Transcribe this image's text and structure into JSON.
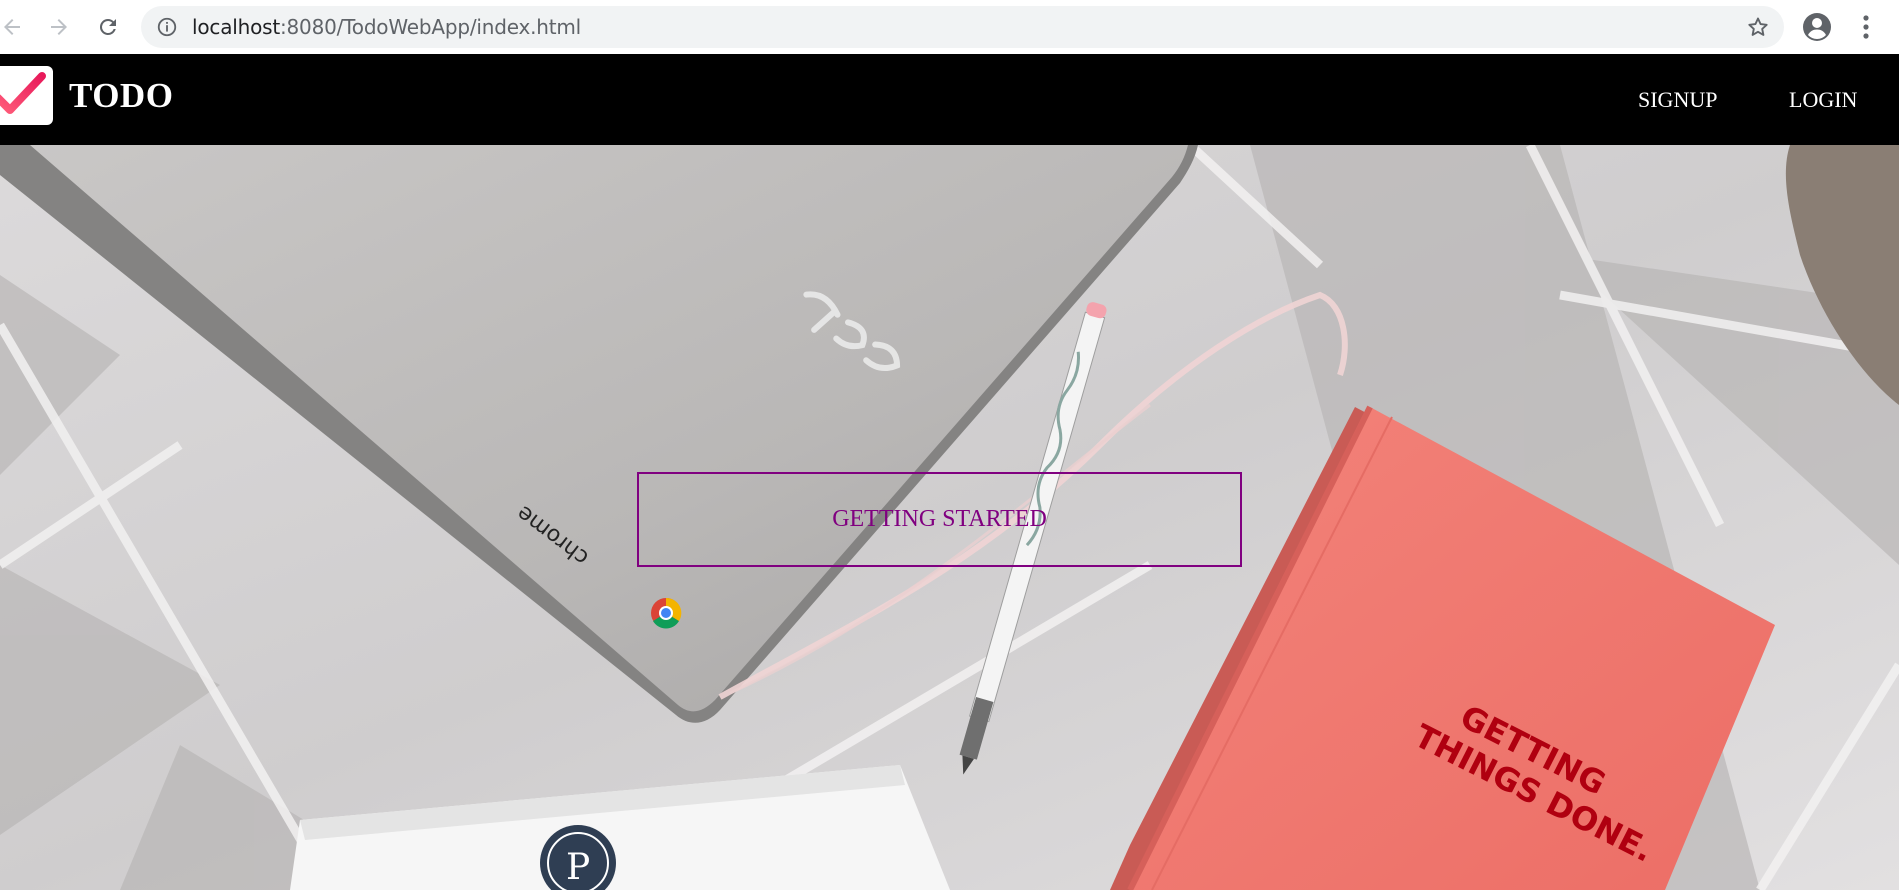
{
  "browser": {
    "url_host": "localhost",
    "url_path": ":8080/TodoWebApp/index.html",
    "icons": [
      "back-arrow-icon",
      "forward-arrow-icon",
      "reload-icon",
      "info-icon",
      "bookmark-star-icon",
      "profile-icon",
      "more-vert-icon"
    ]
  },
  "navbar": {
    "brand": "TODO",
    "signup_label": "SIGNUP",
    "login_label": "LOGIN",
    "logo_icon": "checkmark-icon"
  },
  "hero": {
    "cta_label": "GETTING STARTED",
    "laptop_text": "chrome",
    "notebook_line1": "GETTING",
    "notebook_line2": "THINGS DONE.",
    "badge_letter": "P"
  },
  "colors": {
    "navbar_bg": "#000000",
    "accent": "#800080",
    "notebook": "#f07a72",
    "notebook_text": "#b00010"
  }
}
